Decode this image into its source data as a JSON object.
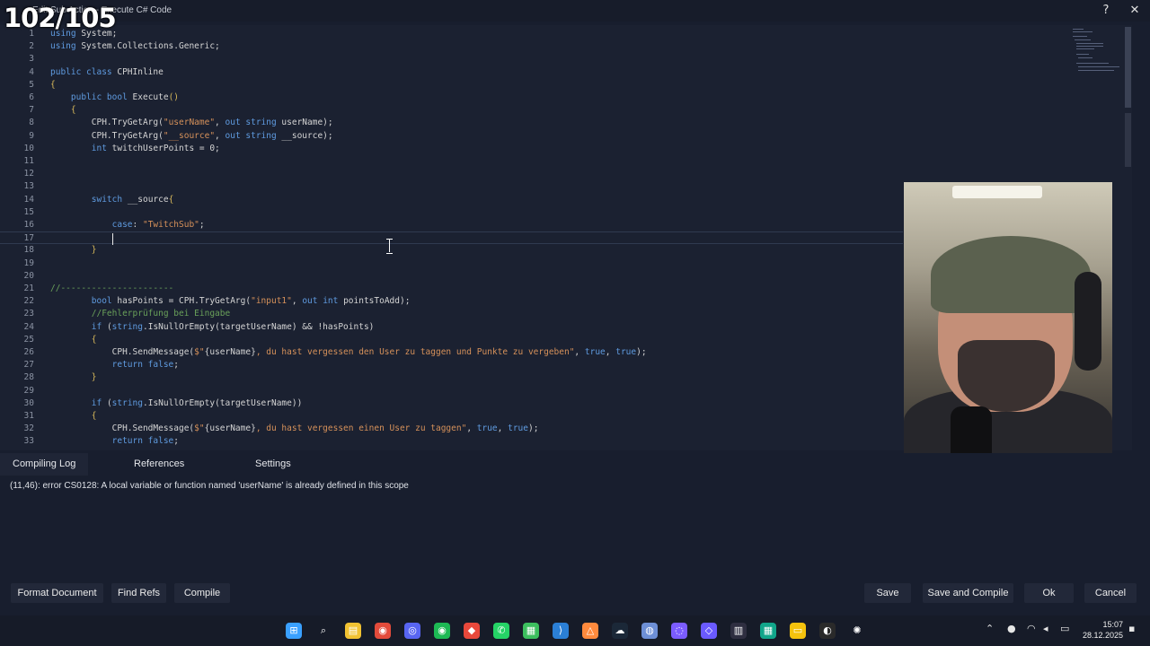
{
  "window": {
    "counter": "102/105",
    "title": "Edit Sub Action - Execute C# Code",
    "help_label": "?",
    "close_label": "✕"
  },
  "editor": {
    "lines": [
      {
        "n": "1",
        "html": "<span class='kw'>using</span> System;"
      },
      {
        "n": "2",
        "html": "<span class='kw'>using</span> System.Collections.Generic;"
      },
      {
        "n": "3",
        "html": ""
      },
      {
        "n": "4",
        "html": "<span class='kw'>public class</span> CPHInline"
      },
      {
        "n": "5",
        "html": "<span class='br'>{</span>"
      },
      {
        "n": "6",
        "html": "    <span class='kw'>public bool</span> Execute<span class='br'>()</span>"
      },
      {
        "n": "7",
        "html": "    <span class='br'>{</span>"
      },
      {
        "n": "8",
        "html": "        CPH.TryGetArg(<span class='str'>\"userName\"</span>, <span class='kw'>out string</span> userName);"
      },
      {
        "n": "9",
        "html": "        CPH.TryGetArg(<span class='str'>\"__source\"</span>, <span class='kw'>out string</span> __source);"
      },
      {
        "n": "10",
        "html": "        <span class='kw'>int</span> twitchUserPoints = 0;"
      },
      {
        "n": "11",
        "html": ""
      },
      {
        "n": "12",
        "html": ""
      },
      {
        "n": "13",
        "html": ""
      },
      {
        "n": "14",
        "html": "        <span class='kw'>switch</span> __source<span class='br'>{</span>"
      },
      {
        "n": "15",
        "html": ""
      },
      {
        "n": "16",
        "html": "            <span class='kw'>case</span>: <span class='str'>\"TwitchSub\"</span>;"
      },
      {
        "n": "17",
        "html": ""
      },
      {
        "n": "18",
        "html": "        <span class='br'>}</span>"
      },
      {
        "n": "19",
        "html": ""
      },
      {
        "n": "20",
        "html": ""
      },
      {
        "n": "21",
        "html": "<span class='cmt'>//----------------------</span>"
      },
      {
        "n": "22",
        "html": "        <span class='kw'>bool</span> hasPoints = CPH.TryGetArg(<span class='str'>\"input1\"</span>, <span class='kw'>out int</span> pointsToAdd);"
      },
      {
        "n": "23",
        "html": "        <span class='cmt'>//Fehlerprüfung bei Eingabe</span>"
      },
      {
        "n": "24",
        "html": "        <span class='kw'>if</span> (<span class='kw'>string</span>.IsNullOrEmpty(targetUserName) &amp;&amp; !hasPoints)"
      },
      {
        "n": "25",
        "html": "        <span class='br'>{</span>"
      },
      {
        "n": "26",
        "html": "            CPH.SendMessage(<span class='str'>$\"</span>{userName}<span class='str'>, du hast vergessen den User zu taggen und Punkte zu vergeben\"</span>, <span class='kw'>true</span>, <span class='kw'>true</span>);"
      },
      {
        "n": "27",
        "html": "            <span class='kw'>return false</span>;"
      },
      {
        "n": "28",
        "html": "        <span class='br'>}</span>"
      },
      {
        "n": "29",
        "html": ""
      },
      {
        "n": "30",
        "html": "        <span class='kw'>if</span> (<span class='kw'>string</span>.IsNullOrEmpty(targetUserName))"
      },
      {
        "n": "31",
        "html": "        <span class='br'>{</span>"
      },
      {
        "n": "32",
        "html": "            CPH.SendMessage(<span class='str'>$\"</span>{userName}<span class='str'>, du hast vergessen einen User zu taggen\"</span>, <span class='kw'>true</span>, <span class='kw'>true</span>);"
      },
      {
        "n": "33",
        "html": "            <span class='kw'>return false</span>;"
      }
    ]
  },
  "tabs": {
    "compiling_log": "Compiling Log",
    "references": "References",
    "settings": "Settings"
  },
  "log": {
    "message": "(11,46): error CS0128: A local variable or function named 'userName' is already defined in this scope"
  },
  "buttons": {
    "format_document": "Format Document",
    "find_refs": "Find Refs",
    "compile": "Compile",
    "save": "Save",
    "save_and_compile": "Save and Compile",
    "ok": "Ok",
    "cancel": "Cancel"
  },
  "taskbar": {
    "time": "15:07",
    "date": "28.12.2025",
    "apps": [
      "windows-start-icon",
      "search-icon",
      "file-explorer-icon",
      "chrome-icon",
      "discord-icon",
      "spotify-icon",
      "app-red-icon",
      "whatsapp-icon",
      "app-green-icon",
      "vscode-icon",
      "app-orange-icon",
      "steam-icon",
      "app-blue-icon",
      "obs-icon",
      "streamerbot-icon",
      "audio-app-icon",
      "app-teal-icon",
      "sticky-notes-icon",
      "app-davinci-icon",
      "chatgpt-icon"
    ]
  }
}
